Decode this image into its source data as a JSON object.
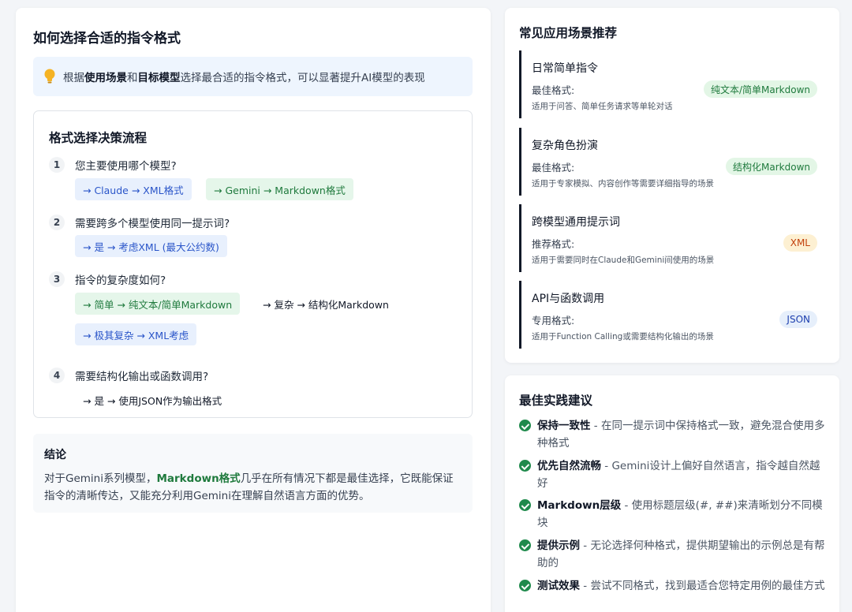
{
  "main": {
    "title": "如何选择合适的指令格式",
    "tip": {
      "prefix": "根据",
      "bold1": "使用场景",
      "mid": "和",
      "bold2": "目标模型",
      "suffix": "选择最合适的指令格式，可以显著提升AI模型的表现"
    },
    "flow": {
      "title": "格式选择决策流程",
      "steps": [
        {
          "num": "1",
          "question": "您主要使用哪个模型?",
          "options": [
            "→ Claude → XML格式",
            "→ Gemini → Markdown格式"
          ]
        },
        {
          "num": "2",
          "question": "需要跨多个模型使用同一提示词?",
          "options": [
            "→ 是 → 考虑XML (最大公约数)"
          ]
        },
        {
          "num": "3",
          "question": "指令的复杂度如何?",
          "options": [
            "→ 简单 → 纯文本/简单Markdown",
            "→ 复杂 → 结构化Markdown",
            "→ 极其复杂 → XML考虑"
          ]
        },
        {
          "num": "4",
          "question": "需要结构化输出或函数调用?",
          "options": [
            "→ 是 → 使用JSON作为输出格式"
          ]
        }
      ]
    },
    "conclusion": {
      "title": "结论",
      "prefix": "对于Gemini系列模型，",
      "highlight": "Markdown格式",
      "suffix": "几乎在所有情况下都是最佳选择，它既能保证指令的清晰传达，又能充分利用Gemini在理解自然语言方面的优势。"
    }
  },
  "scenarios": {
    "title": "常见应用场景推荐",
    "items": [
      {
        "title": "日常简单指令",
        "label": "最佳格式:",
        "badge": "纯文本/简单Markdown",
        "desc": "适用于问答、简单任务请求等单轮对话",
        "badge_bg": "#e3f6e6",
        "badge_color": "#1f7a3d"
      },
      {
        "title": "复杂角色扮演",
        "label": "最佳格式:",
        "badge": "结构化Markdown",
        "desc": "适用于专家模拟、内容创作等需要详细指导的场景",
        "badge_bg": "#e3f6e6",
        "badge_color": "#1f7a3d"
      },
      {
        "title": "跨模型通用提示词",
        "label": "推荐格式:",
        "badge": "XML",
        "desc": "适用于需要同时在Claude和Gemini间使用的场景",
        "badge_bg": "#fdf0d2",
        "badge_color": "#c2410c"
      },
      {
        "title": "API与函数调用",
        "label": "专用格式:",
        "badge": "JSON",
        "desc": "适用于Function Calling或需要结构化输出的场景",
        "badge_bg": "#e6effb",
        "badge_color": "#1e40af"
      }
    ]
  },
  "practices": {
    "title": "最佳实践建议",
    "items": [
      {
        "bold": "保持一致性",
        "text": " - 在同一提示词中保持格式一致，避免混合使用多种格式"
      },
      {
        "bold": "优先自然流畅",
        "text": " - Gemini设计上偏好自然语言，指令越自然越好"
      },
      {
        "bold": "Markdown层级",
        "text": " - 使用标题层级(#, ##)来清晰划分不同模块"
      },
      {
        "bold": "提供示例",
        "text": " - 无论选择何种格式，提供期望输出的示例总是有帮助的"
      },
      {
        "bold": "测试效果",
        "text": " - 尝试不同格式，找到最适合您特定用例的最佳方式"
      }
    ]
  },
  "colors": {
    "accent_blue": "#2a55c9",
    "accent_green": "#1f7a3d",
    "check_green": "#1f8a4c"
  }
}
